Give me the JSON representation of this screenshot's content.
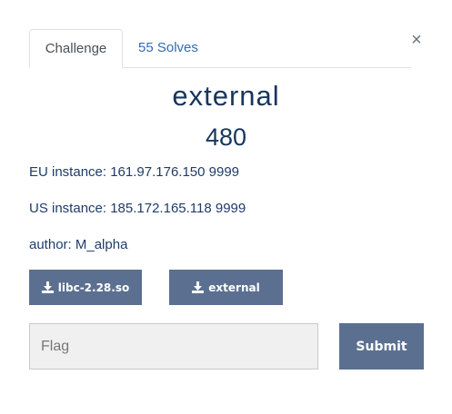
{
  "tabs": {
    "challenge": "Challenge",
    "solves": "55 Solves"
  },
  "close_symbol": "×",
  "challenge": {
    "name": "external",
    "value": "480",
    "description": {
      "eu": "EU instance: 161.97.176.150 9999",
      "us": "US instance: 185.172.165.118 9999",
      "author": "author: M_alpha"
    }
  },
  "files": [
    {
      "label": "libc-2.28.so",
      "icon": "download-icon"
    },
    {
      "label": "external",
      "icon": "download-icon"
    }
  ],
  "flag_form": {
    "placeholder": "Flag",
    "submit_label": "Submit"
  },
  "colors": {
    "accent": "#5b7090",
    "link": "#2f6db5",
    "title": "#17365d"
  }
}
